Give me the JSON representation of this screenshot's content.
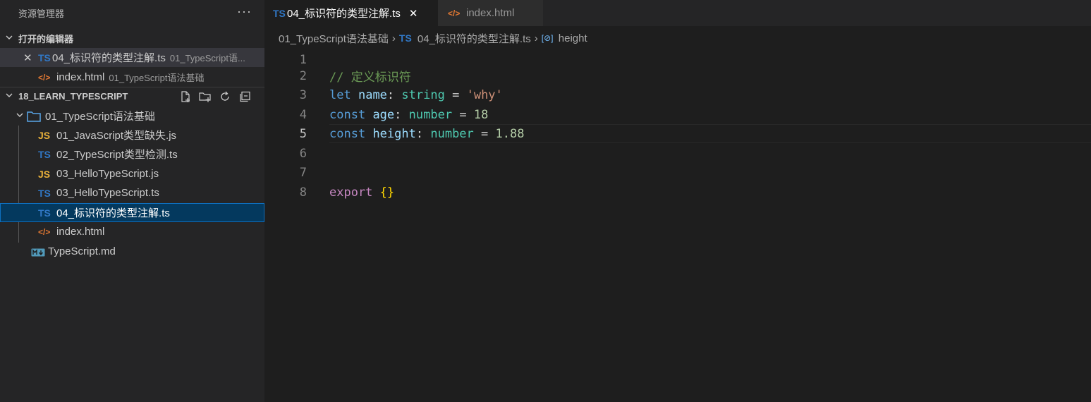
{
  "sidebar": {
    "title": "资源管理器",
    "more": "···",
    "open_editors": {
      "header": "打开的编辑器",
      "items": [
        {
          "icon": "TS",
          "name": "04_标识符的类型注解.ts",
          "desc": "01_TypeScript语..."
        },
        {
          "icon": "</>",
          "name": "index.html",
          "desc": "01_TypeScript语法基础"
        }
      ]
    },
    "project": {
      "header": "18_LEARN_TYPESCRIPT",
      "folder": "01_TypeScript语法基础",
      "files": [
        {
          "icon": "JS",
          "name": "01_JavaScript类型缺失.js"
        },
        {
          "icon": "TS",
          "name": "02_TypeScript类型检测.ts"
        },
        {
          "icon": "JS",
          "name": "03_HelloTypeScript.js"
        },
        {
          "icon": "TS",
          "name": "03_HelloTypeScript.ts"
        },
        {
          "icon": "TS",
          "name": "04_标识符的类型注解.ts"
        },
        {
          "icon": "</>",
          "name": "index.html"
        }
      ],
      "root_file": "TypeScript.md"
    }
  },
  "tabs": [
    {
      "icon": "TS",
      "label": "04_标识符的类型注解.ts",
      "close": "✕"
    },
    {
      "icon": "</>",
      "label": "index.html"
    }
  ],
  "breadcrumb": {
    "folder": "01_TypeScript语法基础",
    "file_icon": "TS",
    "file": "04_标识符的类型注解.ts",
    "symbol_icon": "[⊘]",
    "symbol": "height",
    "sep": "›"
  },
  "editor": {
    "line_numbers": [
      "1",
      "2",
      "3",
      "4",
      "5",
      "6",
      "7",
      "8"
    ],
    "line2": {
      "comment": "// 定义标识符"
    },
    "line3": {
      "kw": "let",
      "name": "name",
      "colon": ":",
      "type": "string",
      "eq": "=",
      "value": "'why'"
    },
    "line4": {
      "kw": "const",
      "name": "age",
      "colon": ":",
      "type": "number",
      "eq": "=",
      "value": "18"
    },
    "line5": {
      "kw": "const",
      "name": "height",
      "colon": ":",
      "type": "number",
      "eq": "=",
      "value": "1.88"
    },
    "line8": {
      "kw": "export",
      "braces": "{}"
    }
  },
  "colors": {
    "ts": "#3178c6",
    "js": "#e8b03a",
    "html": "#e37933",
    "selection": "#04395e"
  }
}
